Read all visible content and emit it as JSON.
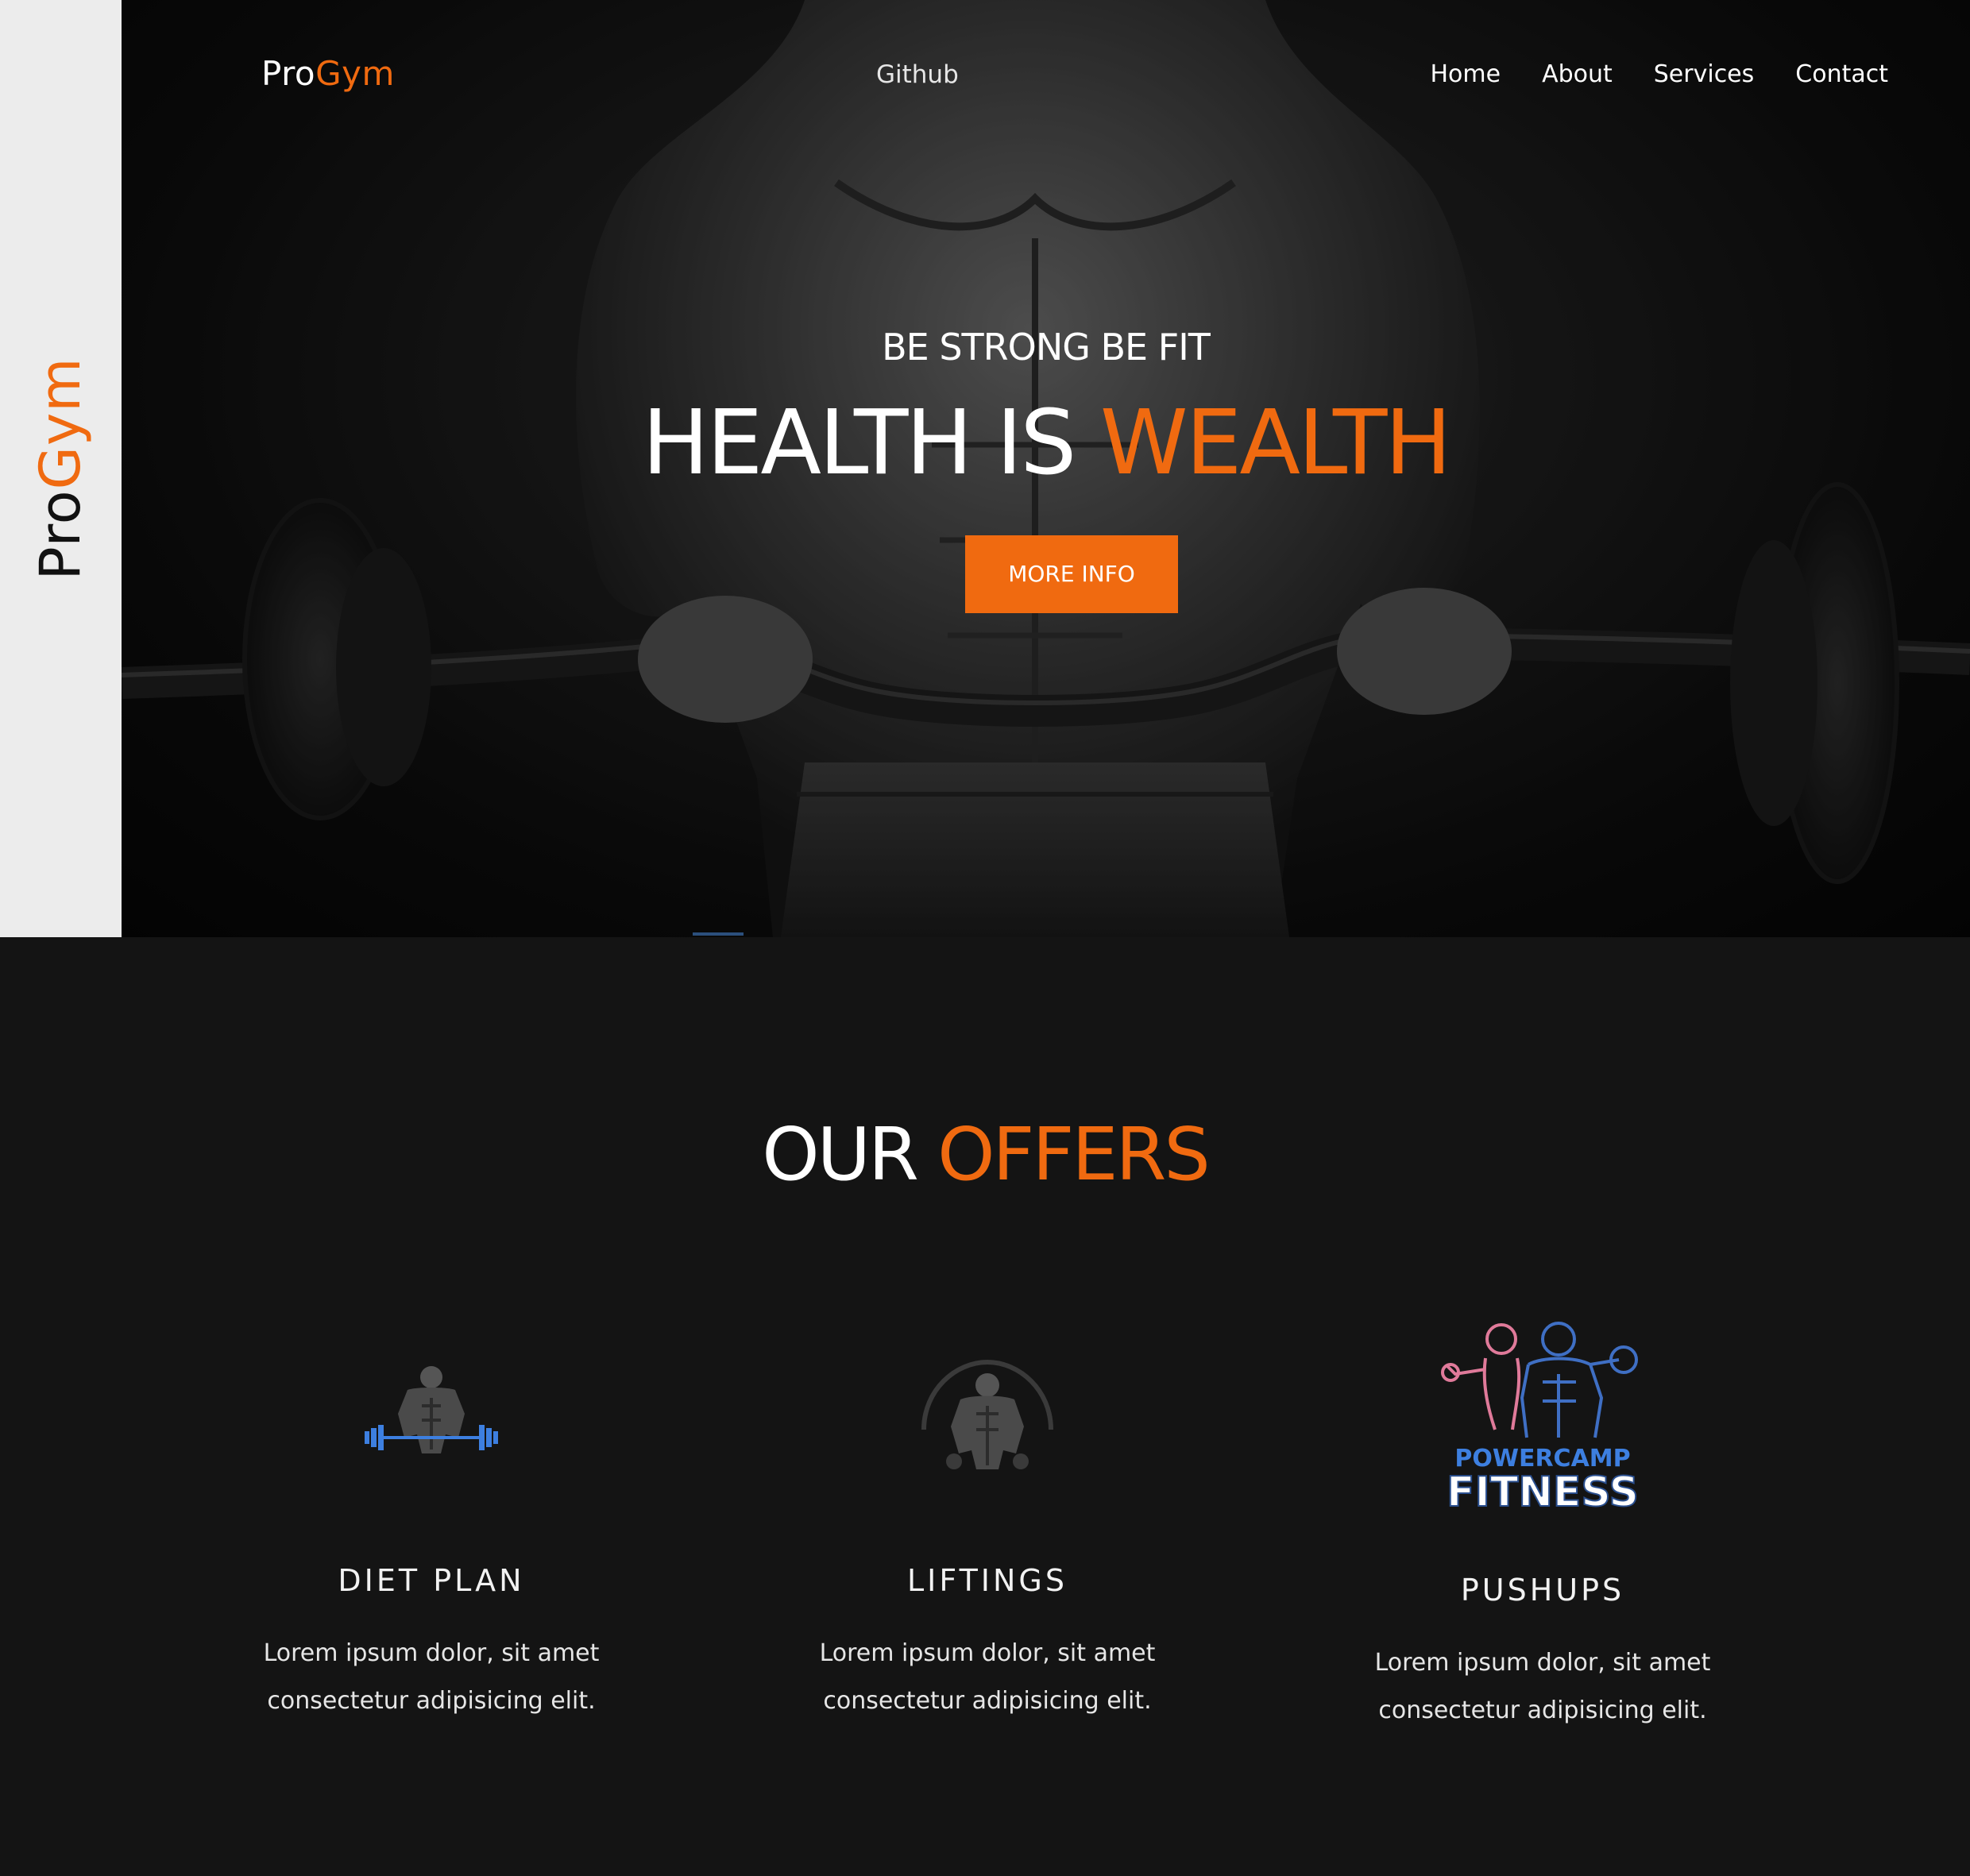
{
  "brand": {
    "pro": "Pro",
    "gym": "Gym"
  },
  "nav": {
    "github": "Github",
    "links": [
      "Home",
      "About",
      "Services",
      "Contact"
    ]
  },
  "hero": {
    "subtitle": "BE STRONG BE FIT",
    "title_white": "HEALTH IS ",
    "title_orange": "WEALTH",
    "button": "MORE INFO"
  },
  "offers": {
    "title_white": "OUR ",
    "title_orange": "OFFERS",
    "cards": [
      {
        "title": "DIET PLAN",
        "text_line1": "Lorem ipsum dolor, sit amet",
        "text_line2": "consectetur adipisicing elit.",
        "icon": "weightlifter-icon"
      },
      {
        "title": "LIFTINGS",
        "text_line1": "Lorem ipsum dolor, sit amet",
        "text_line2": "consectetur adipisicing elit.",
        "icon": "bodybuilder-icon"
      },
      {
        "title": "PUSHUPS",
        "text_line1": "Lorem ipsum dolor, sit amet",
        "text_line2": "consectetur adipisicing elit.",
        "icon": "powercamp-fitness-logo",
        "logo_line1": "POWERCAMP",
        "logo_line2": "FITNESS"
      }
    ]
  },
  "colors": {
    "accent": "#f06a10",
    "background": "#141414",
    "side_strip": "#ececec",
    "icon_blue": "#3d7fe0"
  }
}
